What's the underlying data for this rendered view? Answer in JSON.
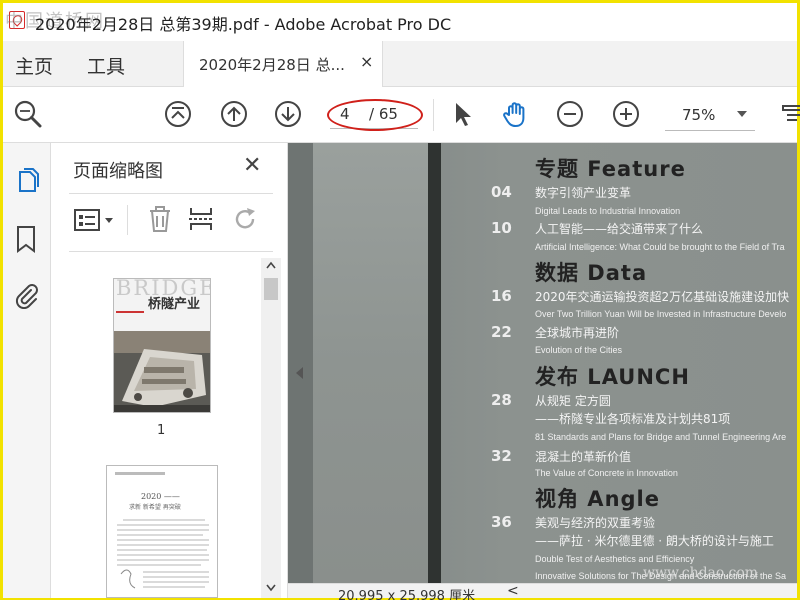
{
  "window": {
    "title": "2020年2月28日 总第39期.pdf - Adobe Acrobat Pro DC",
    "watermark_top": "中国道桥网"
  },
  "tabs": {
    "home": "主页",
    "tools": "工具",
    "document": "2020年2月28日 总...",
    "close": "×"
  },
  "toolbar": {
    "page_current": "4",
    "page_total": "/ 65",
    "zoom": "75%"
  },
  "thumbnails_panel": {
    "title": "页面缩略图",
    "close": "✕",
    "thumbs": [
      {
        "label": "1",
        "cover_title": "桥隧产业",
        "cover_brand": "BRIDGE"
      },
      {
        "label": "",
        "snippet_title": "2020 ——",
        "snippet_sub": "求新 新希望 再突破"
      }
    ]
  },
  "document": {
    "sections": [
      {
        "heading": "专题 Feature",
        "items": [
          {
            "num": "04",
            "cn": "数字引领产业变革",
            "en": "Digital Leads to Industrial Innovation"
          },
          {
            "num": "10",
            "cn": "人工智能——给交通带来了什么",
            "en": "Artificial Intelligence: What Could be brought to the Field of Tra"
          }
        ]
      },
      {
        "heading": "数据 Data",
        "items": [
          {
            "num": "16",
            "cn": "2020年交通运输投资超2万亿基础设施建设加快",
            "en": "Over Two Trillion Yuan Will be Invested in Infrastructure Develo"
          },
          {
            "num": "22",
            "cn": "全球城市再进阶",
            "en": "Evolution of the Cities"
          }
        ]
      },
      {
        "heading": "发布 LAUNCH",
        "items": [
          {
            "num": "28",
            "cn": "从规矩  定方圆",
            "cn2": "——桥隧专业各项标准及计划共81项",
            "en": "81 Standards and Plans for Bridge and Tunnel Engineering Are"
          },
          {
            "num": "32",
            "cn": "混凝土的革新价值",
            "en": "The Value of Concrete in Innovation"
          }
        ]
      },
      {
        "heading": "视角 Angle",
        "items": [
          {
            "num": "36",
            "cn": "美观与经济的双重考验",
            "cn2": "——萨拉 · 米尔德里德 · 朗大桥的设计与施工",
            "en": "Double Test of Aesthetics and Efficiency",
            "en2": "Innovative Solutions for The Design and Construction of the Sa"
          }
        ]
      }
    ],
    "watermark": "www.chdao.com"
  },
  "status": {
    "page_size": "20.995 x 25.998 厘米",
    "arrow": "<"
  },
  "colors": {
    "accent_blue": "#1a73c8",
    "annotation_red": "#d0201a",
    "window_border": "#f2e200"
  }
}
